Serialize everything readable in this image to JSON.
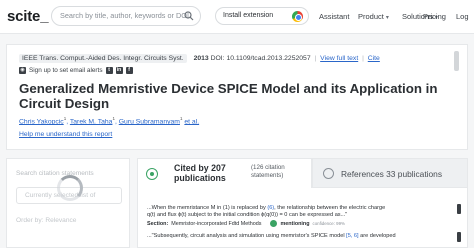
{
  "nav": {
    "logo": "scite_",
    "search_placeholder": "Search by title, author, keywords or DOI",
    "install_label": "Install extension",
    "links": [
      "Assistant",
      "Product",
      "Solutions",
      "Pricing",
      "Log"
    ]
  },
  "paper": {
    "journal": "IEEE Trans. Comput.-Aided Des. Integr. Circuits Syst.",
    "year": "2013",
    "doi": "DOI: 10.1109/tcad.2013.2252057",
    "view_full_text": "View full text",
    "cite": "Cite",
    "alert": "Sign up to set email alerts",
    "title": "Generalized Memristive Device SPICE Model and its Application in Circuit Design",
    "authors": [
      "Chris Yakopcic",
      "Tarek M. Taha",
      "Guru Subramanyam"
    ],
    "author_sup": "1",
    "et_al": "et al.",
    "help_link": "Help me understand this report"
  },
  "left_panel": {
    "search_heading": "Search citation statements",
    "filter_placeholder": "Currently selected list of",
    "order_by": "Order by: Relevance"
  },
  "tabs": {
    "cited_by": "Cited by 207 publications",
    "statements": "(126 citation statements)",
    "references": "References 33 publications"
  },
  "citations": [
    {
      "line1": "...When the memristance M in (1) is replaced by",
      "ref": "(6)",
      "line1_end": ", the relationship between the electric charge",
      "line2": "q(t) and flux ϕ(t) subject to the initial condition ϕ(q(0)) = 0 can be expressed as...\"",
      "section_label": "Section:",
      "section": "Memristor-incorporated Fdtd Methods",
      "type": "mentioning",
      "confidence": "confidence: 99%"
    },
    {
      "line1": "...\"Subsequently, circuit analysis and simulation using memristor's SPICE model",
      "ref": "[5, 6]",
      "line1_end": "are developed"
    }
  ]
}
